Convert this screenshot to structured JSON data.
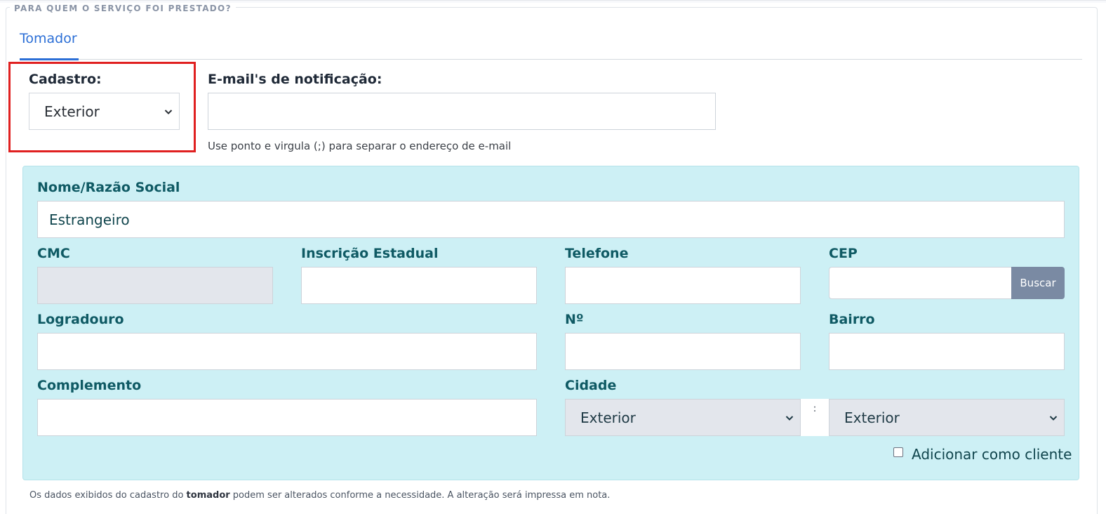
{
  "section": {
    "legend": "PARA QUEM O SERVIÇO FOI PRESTADO?"
  },
  "tabs": [
    {
      "label": "Tomador",
      "active": true
    }
  ],
  "cadastro": {
    "label": "Cadastro:",
    "selected": "Exterior"
  },
  "emails": {
    "label": "E-mail's de notificação:",
    "value": "",
    "help": "Use ponto e virgula (;) para separar o endereço de e-mail"
  },
  "form": {
    "nome": {
      "label": "Nome/Razão Social",
      "value": "Estrangeiro"
    },
    "cmc": {
      "label": "CMC",
      "value": ""
    },
    "inscricao": {
      "label": "Inscrição Estadual",
      "value": ""
    },
    "telefone": {
      "label": "Telefone",
      "value": ""
    },
    "cep": {
      "label": "CEP",
      "value": "",
      "button": "Buscar"
    },
    "logradouro": {
      "label": "Logradouro",
      "value": ""
    },
    "numero": {
      "label": "Nº",
      "value": ""
    },
    "bairro": {
      "label": "Bairro",
      "value": ""
    },
    "complemento": {
      "label": "Complemento",
      "value": ""
    },
    "cidade": {
      "label": "Cidade",
      "selected_left": "Exterior",
      "separator": ":",
      "selected_right": "Exterior"
    },
    "add_cliente": {
      "label": "Adicionar como cliente",
      "checked": false
    }
  },
  "footnote": {
    "before": "Os dados exibidos do cadastro do ",
    "bold": "tomador",
    "after": " podem ser alterados conforme a necessidade. A alteração será impressa em nota."
  },
  "colors": {
    "accent": "#2c6fd6",
    "panel_bg": "#cdf0f5",
    "highlight": "#e02020",
    "button": "#7a8aa3"
  }
}
